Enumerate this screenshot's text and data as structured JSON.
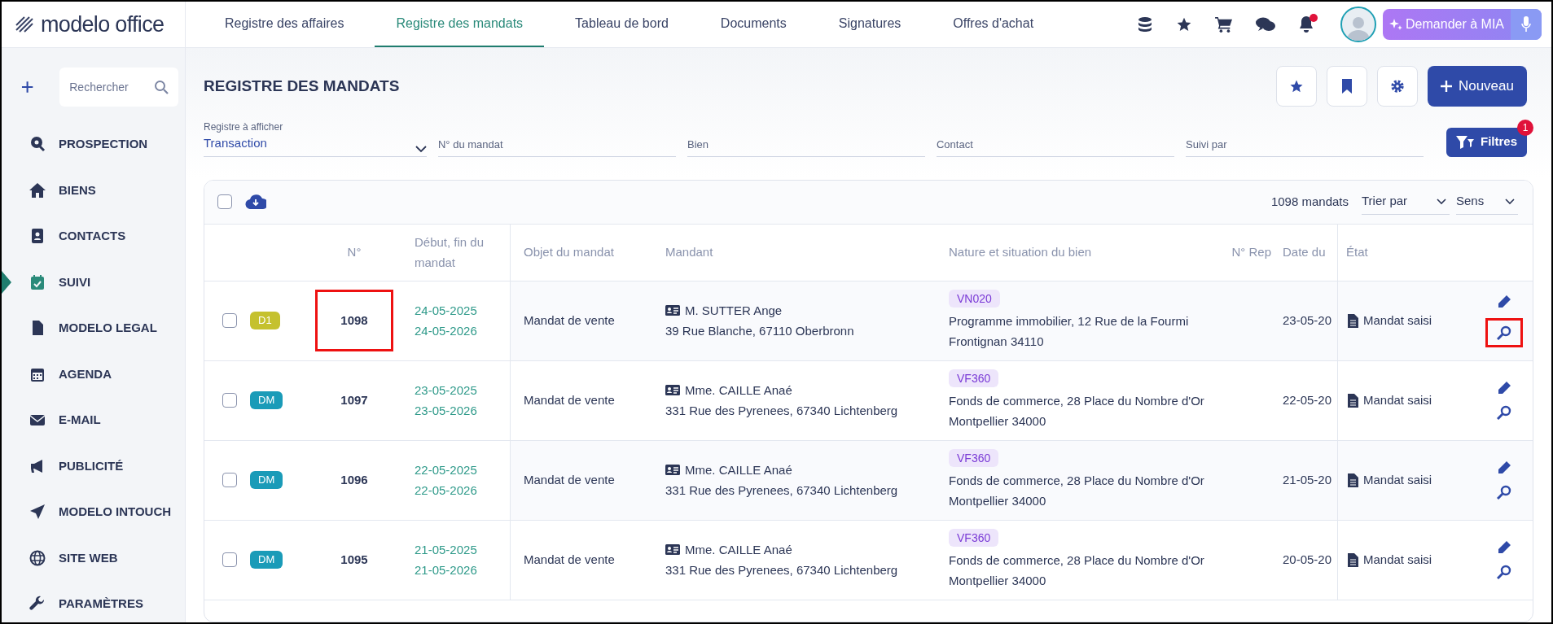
{
  "logo": "modelo office",
  "nav_tabs": [
    {
      "label": "Registre des affaires",
      "selected": false
    },
    {
      "label": "Registre des mandats",
      "selected": true
    },
    {
      "label": "Tableau de bord",
      "selected": false
    },
    {
      "label": "Documents",
      "selected": false
    },
    {
      "label": "Signatures",
      "selected": false
    },
    {
      "label": "Offres d'achat",
      "selected": false
    }
  ],
  "notifications_unread": true,
  "assistant_button": "Demander à MIA",
  "sidebar": {
    "search_placeholder": "Rechercher",
    "items": [
      {
        "label": "PROSPECTION",
        "kind": "search",
        "selected": false
      },
      {
        "label": "BIENS",
        "kind": "home",
        "selected": false
      },
      {
        "label": "CONTACTS",
        "kind": "contacts",
        "selected": false
      },
      {
        "label": "SUIVI",
        "kind": "calendar-check",
        "selected": true
      },
      {
        "label": "MODELO LEGAL",
        "kind": "file",
        "selected": false
      },
      {
        "label": "AGENDA",
        "kind": "calendar",
        "selected": false
      },
      {
        "label": "E-MAIL",
        "kind": "mail",
        "selected": false
      },
      {
        "label": "PUBLICITÉ",
        "kind": "megaphone",
        "selected": false
      },
      {
        "label": "MODELO INTOUCH",
        "kind": "send",
        "selected": false
      },
      {
        "label": "SITE WEB",
        "kind": "globe",
        "selected": false
      },
      {
        "label": "PARAMÈTRES",
        "kind": "wrench",
        "selected": false
      }
    ]
  },
  "page_title": "REGISTRE DES MANDATS",
  "new_button": "Nouveau",
  "filters": {
    "register_label": "Registre à afficher",
    "register_value": "Transaction",
    "fields": [
      {
        "placeholder": "N° du mandat"
      },
      {
        "placeholder": "Bien"
      },
      {
        "placeholder": "Contact"
      },
      {
        "placeholder": "Suivi par"
      }
    ],
    "button": "Filtres",
    "badge": "1"
  },
  "table": {
    "select_all_checked": false,
    "count": "1098 mandats",
    "sort": "Trier par",
    "direction": "Sens",
    "columns": [
      "N°",
      "Début, fin du mandat",
      "Objet du mandat",
      "Mandant",
      "Nature et situation du bien",
      "N° Rep",
      "Date du",
      "État"
    ],
    "rows": [
      {
        "badge": "D1",
        "color": "#c5c12e",
        "number": "1098",
        "start": "24-05-2025",
        "end": "24-05-2026",
        "object": "Mandat de vente",
        "client": "M. SUTTER Ange",
        "address": "39 Rue Blanche, 67110 Oberbronn",
        "tag": "VN020",
        "property": "Programme immobilier, 12 Rue de la Fourmi",
        "city": "Frontignan 34110",
        "date": "23-05-20",
        "state": "Mandat saisi",
        "highlighted": true,
        "checked": false
      },
      {
        "badge": "DM",
        "color": "#1a9bb8",
        "number": "1097",
        "start": "23-05-2025",
        "end": "23-05-2026",
        "object": "Mandat de vente",
        "client": "Mme. CAILLE Anaé",
        "address": "331 Rue des Pyrenees, 67340 Lichtenberg",
        "tag": "VF360",
        "property": "Fonds de commerce, 28 Place du Nombre d'Or",
        "city": "Montpellier 34000",
        "date": "22-05-20",
        "state": "Mandat saisi",
        "highlighted": false,
        "checked": false
      },
      {
        "badge": "DM",
        "color": "#1a9bb8",
        "number": "1096",
        "start": "22-05-2025",
        "end": "22-05-2026",
        "object": "Mandat de vente",
        "client": "Mme. CAILLE Anaé",
        "address": "331 Rue des Pyrenees, 67340 Lichtenberg",
        "tag": "VF360",
        "property": "Fonds de commerce, 28 Place du Nombre d'Or",
        "city": "Montpellier 34000",
        "date": "21-05-20",
        "state": "Mandat saisi",
        "highlighted": false,
        "checked": false
      },
      {
        "badge": "DM",
        "color": "#1a9bb8",
        "number": "1095",
        "start": "21-05-2025",
        "end": "21-05-2026",
        "object": "Mandat de vente",
        "client": "Mme. CAILLE Anaé",
        "address": "331 Rue des Pyrenees, 67340 Lichtenberg",
        "tag": "VF360",
        "property": "Fonds de commerce, 28 Place du Nombre d'Or",
        "city": "Montpellier 34000",
        "date": "20-05-20",
        "state": "Mandat saisi",
        "highlighted": false,
        "checked": false
      }
    ]
  }
}
